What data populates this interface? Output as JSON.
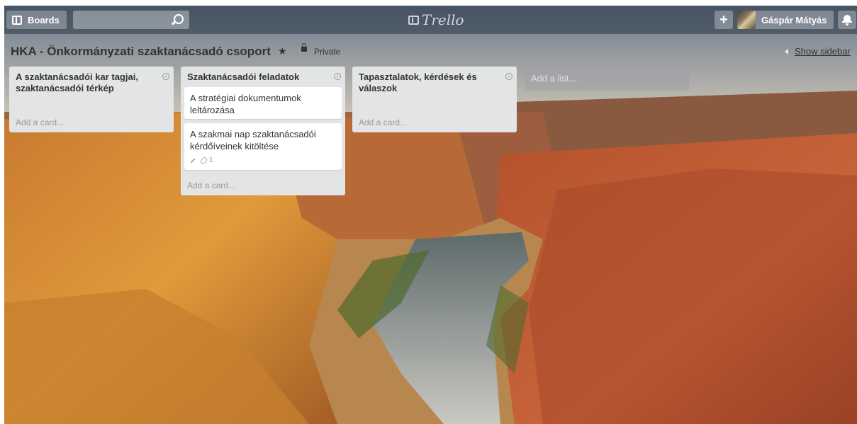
{
  "header": {
    "boards_label": "Boards",
    "search_value": "",
    "logo_text": "Trello",
    "member_name": "Gáspár Mátyás"
  },
  "board": {
    "title": "HKA - Önkormányzati szaktanácsadó csoport",
    "visibility": "Private",
    "show_sidebar": "Show sidebar"
  },
  "lists": [
    {
      "title_line1": "A szaktanácsadói kar tagjai,",
      "title_line2": "szaktanácsadói térkép",
      "cards": [],
      "add_card": "Add a card..."
    },
    {
      "title_line1": "Szaktanácsadói feladatok",
      "cards": [
        {
          "line1": "A stratégiai dokumentumok",
          "line2": "leltározása"
        },
        {
          "line1": "A szakmai nap szaktanácsadói",
          "line2": "kérdőíveinek kitöltése",
          "attachments": "1"
        }
      ],
      "add_card": "Add a card..."
    },
    {
      "title_line1": "Tapasztalatok, kérdések és",
      "title_line2": "válaszok",
      "cards": [],
      "add_card": "Add a card..."
    }
  ],
  "add_list": "Add a list...",
  "icons": [
    "boards-icon",
    "search-icon",
    "trello-logo-icon",
    "plus-icon",
    "avatar",
    "bell-icon",
    "star-icon",
    "lock-icon",
    "list-menu-icon",
    "pencil-icon",
    "attachment-icon"
  ],
  "colors": {
    "list_bg": "#e2e4e6",
    "card_bg": "#ffffff",
    "header_overlay": "#283442"
  }
}
